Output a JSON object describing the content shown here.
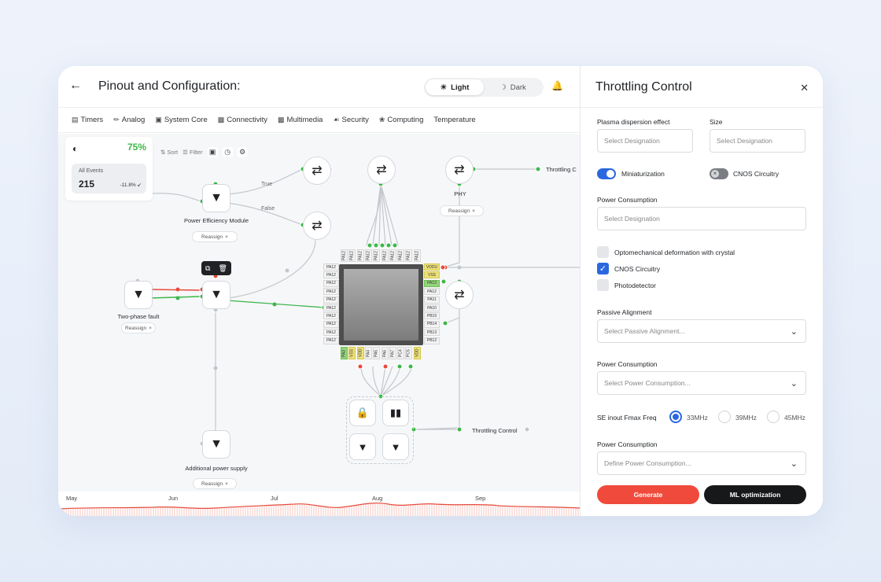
{
  "header": {
    "title": "Pinout and Configuration:",
    "theme_light": "Light",
    "theme_dark": "Dark"
  },
  "tabs": [
    {
      "label": "Timers",
      "icon": "timer-icon"
    },
    {
      "label": "Analog",
      "icon": "analog-icon"
    },
    {
      "label": "System Core",
      "icon": "system-core-icon"
    },
    {
      "label": "Connectivity",
      "icon": "connectivity-icon"
    },
    {
      "label": "Multimedia",
      "icon": "multimedia-icon"
    },
    {
      "label": "Security",
      "icon": "security-icon"
    },
    {
      "label": "Computing",
      "icon": "computing-icon"
    },
    {
      "label": "Temperature",
      "icon": ""
    }
  ],
  "stats": {
    "percent": "75%",
    "events_label": "All Events",
    "events_value": "215",
    "events_delta": "-11.8%"
  },
  "toolbar": {
    "sort": "Sort",
    "filter": "Filter"
  },
  "nodes": {
    "power_efficiency": "Power Efficiency Module",
    "two_phase": "Two-phase fault",
    "additional": "Additional power supply",
    "phy": "PHY",
    "reassign": "Reassign",
    "true_label": "True",
    "false_label": "False",
    "throttling_top": "Throttling C",
    "throttling_bottom": "Throttling Control"
  },
  "chip": {
    "top_pins": [
      "PA12",
      "PA12",
      "PA12",
      "PA12",
      "PA12",
      "PA12",
      "PA12",
      "PA12",
      "PA12",
      "PA12"
    ],
    "left_pins": [
      "PA12",
      "PA12",
      "PA12",
      "PA12",
      "PA12",
      "PA12",
      "PA12",
      "PA12",
      "PA12",
      "PA12"
    ],
    "right_pins": [
      "VDDU",
      "VSS",
      "PA13",
      "PA12",
      "PA11",
      "PA10",
      "PB15",
      "PB14",
      "PB13",
      "PB12"
    ],
    "bottom_pins": [
      "PA3",
      "VSS",
      "VDD",
      "PA4",
      "PA5",
      "PA6",
      "PA7",
      "PC4",
      "PC5",
      "VDD"
    ]
  },
  "timeline": {
    "months": [
      "May",
      "Jun",
      "Jul",
      "Aug",
      "Sep"
    ]
  },
  "panel": {
    "title": "Throttling Control",
    "plasma_label": "Plasma dispersion effect",
    "size_label": "Size",
    "plasma_placeholder": "Select Designation",
    "size_placeholder": "Select Designation",
    "miniaturization": "Miniaturization",
    "cnos_toggle": "CNOS Circuitry",
    "power_consumption_label": "Power Consumption",
    "power_consumption_placeholder": "Select Designation",
    "cb1": "Optomechanical deformation with crystal",
    "cb2": "CNOS Circuitry",
    "cb3": "Photodetector",
    "passive_label": "Passive Alignment",
    "passive_placeholder": "Select Passive Alignment...",
    "pc2_label": "Power Consumption",
    "pc2_placeholder": "Select Power Consumption...",
    "freq_label": "SE inout Fmax Freq",
    "freq_options": [
      "33MHz",
      "39MHz",
      "45MHz"
    ],
    "pc3_label": "Power Consumption",
    "pc3_placeholder": "Define Power Consumption...",
    "generate": "Generate",
    "ml": "ML optimization"
  },
  "colors": {
    "accent": "#2b68e0",
    "generate": "#ef4a3b",
    "ml": "#17181a",
    "green": "#3cb84a",
    "red": "#e64a3b"
  }
}
